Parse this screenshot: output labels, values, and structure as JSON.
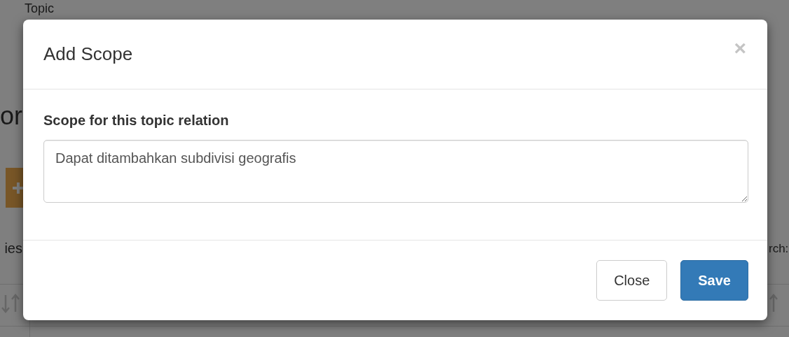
{
  "background": {
    "texts": [
      "Topic",
      "or",
      "ies",
      "rch:"
    ]
  },
  "modal": {
    "title": "Add Scope",
    "close_icon": "×",
    "label": "Scope for this topic relation",
    "textarea": {
      "value": "Dapat ditambahkan subdivisi geografis"
    },
    "buttons": [
      {
        "label": "Close",
        "kind": "default"
      },
      {
        "label": "Save",
        "kind": "primary"
      }
    ]
  }
}
